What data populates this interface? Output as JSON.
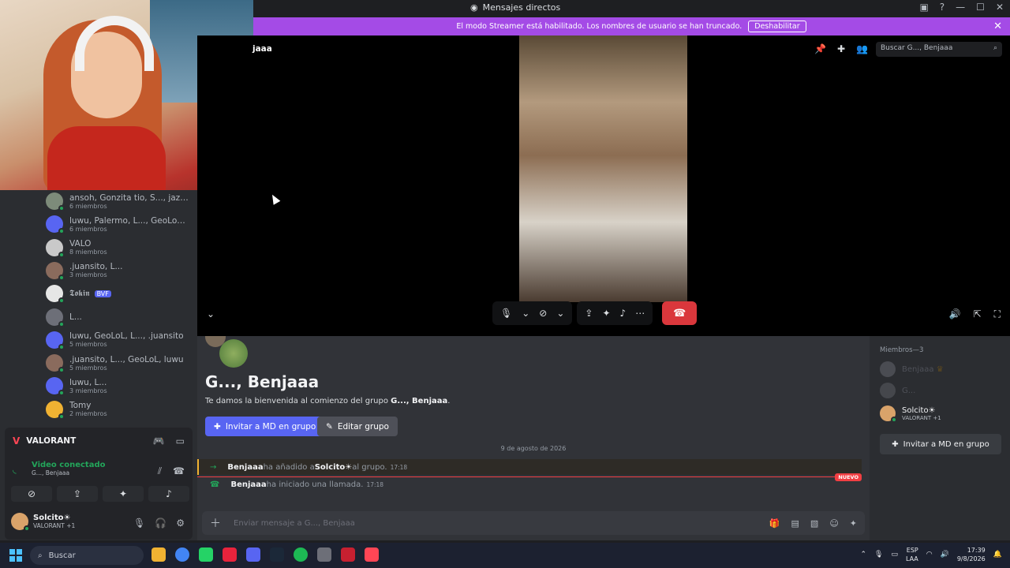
{
  "window": {
    "title": "Mensajes directos"
  },
  "streamer_banner": {
    "text": "El modo Streamer está habilitado. Los nombres de usuario se han truncado.",
    "button": "Deshabilitar"
  },
  "dm_list": [
    {
      "name": "ansoh, Gonzita tio, S..., jazz ☆, T...",
      "sub": "6 miembros",
      "color": "#7d8b7a"
    },
    {
      "name": "luwu, Palermo, L..., GeoLoL, .ju...",
      "sub": "6 miembros",
      "color": "#5865f2"
    },
    {
      "name": "VALO",
      "sub": "8 miembros",
      "color": "#c9c9c9"
    },
    {
      "name": ".juansito, L...",
      "sub": "3 miembros",
      "color": "#8a6b5d"
    },
    {
      "name": "𝕿𝖔𝖐𝖎𝖓",
      "sub": "",
      "tag": "BVF",
      "color": "#e6e6e6"
    },
    {
      "name": "L...",
      "sub": "",
      "color": "#6d6f78"
    },
    {
      "name": "luwu, GeoLoL, L..., .juansito",
      "sub": "5 miembros",
      "color": "#5865f2"
    },
    {
      "name": ".juansito, L..., GeoLoL, luwu",
      "sub": "5 miembros",
      "color": "#8a6b5d"
    },
    {
      "name": "luwu, L...",
      "sub": "3 miembros",
      "color": "#5865f2"
    },
    {
      "name": "Tomy",
      "sub": "2 miembros",
      "color": "#f0b232"
    }
  ],
  "game_panel": {
    "game": "VALORANT",
    "voice_status": "Video conectado",
    "voice_sub": "G..., Benjaaa"
  },
  "user": {
    "name": "Solcito☀",
    "activity": "VALORANT +1"
  },
  "call": {
    "group_name": "jaaa",
    "search_placeholder": "Buscar G..., Benjaaa"
  },
  "chat": {
    "group_title": "G..., Benjaaa",
    "welcome_prefix": "Te damos la bienvenida al comienzo del grupo ",
    "welcome_group": "G..., Benjaaa",
    "welcome_suffix": ".",
    "invite_button": "Invitar a MD en grupo",
    "edit_button": "Editar grupo",
    "date_divider": "9 de agosto de 2026",
    "msg1_actor": "Benjaaa",
    "msg1_mid": " ha añadido a ",
    "msg1_target": "Solcito☀",
    "msg1_end": " al grupo.",
    "msg1_time": "17:18",
    "new_badge": "NUEVO",
    "msg2_actor": "Benjaaa",
    "msg2_text": " ha iniciado una llamada.",
    "msg2_time": "17:18",
    "composer_placeholder": "Enviar mensaje a G..., Benjaaa"
  },
  "members": {
    "header": "Miembros—3",
    "list": [
      {
        "name": "Benjaaa",
        "crown": "♛",
        "online": false
      },
      {
        "name": "G...",
        "online": false
      },
      {
        "name": "Solcito☀",
        "activity": "VALORANT +1",
        "online": true
      }
    ],
    "invite_button": "Invitar a MD en grupo"
  },
  "taskbar": {
    "search": "Buscar",
    "lang1": "ESP",
    "lang2": "LAA",
    "time": "17:39",
    "date": "9/8/2026"
  },
  "colors": {
    "brand": "#5865f2",
    "streamer": "#a44be6",
    "online": "#23a55a",
    "hangup": "#da373c"
  }
}
